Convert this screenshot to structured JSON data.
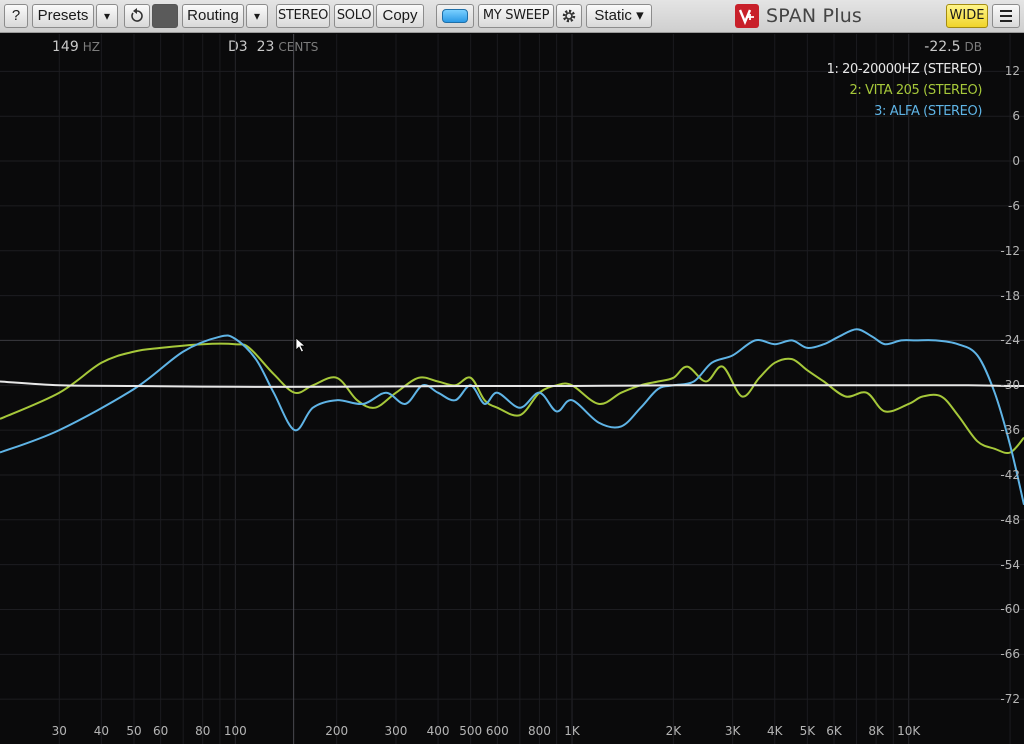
{
  "toolbar": {
    "help_label": "?",
    "presets_label": "Presets",
    "routing_label": "Routing",
    "stereo_label": "STEREO",
    "solo_label": "SOLO",
    "copy_label": "Copy",
    "sweep_label": "MY SWEEP",
    "mode_label": "Static ▾",
    "brand_label": "SPAN Plus",
    "wide_label": "WIDE",
    "arrow_glyph": "▾"
  },
  "readout": {
    "freq_value": "149",
    "freq_unit": "HZ",
    "note_value": "D3",
    "cents_value": "23",
    "cents_unit": "CENTS",
    "db_value": "-22.5",
    "db_unit": "DB"
  },
  "colors": {
    "series1": "#e8e8e8",
    "series2": "#a6c83a",
    "series3": "#5fb4e6",
    "toolbar_bg": "#d9d9d9",
    "wide_yellow": "#f5e04a"
  },
  "chart_data": {
    "type": "line",
    "x_scale": "log",
    "x_unit": "Hz",
    "xlim": [
      20,
      22000
    ],
    "ylim": [
      -78,
      17
    ],
    "y_unit": "dB",
    "grid": true,
    "legend_position": "top-right",
    "y_ticks": [
      "12",
      "6",
      "0",
      "-6",
      "-12",
      "-18",
      "-24",
      "-30",
      "-36",
      "-42",
      "-48",
      "-54",
      "-60",
      "-66",
      "-72"
    ],
    "x_ticks": [
      "30",
      "40",
      "50",
      "60",
      "80",
      "100",
      "200",
      "300",
      "400",
      "500",
      "600",
      "800",
      "1K",
      "2K",
      "3K",
      "4K",
      "5K",
      "6K",
      "8K",
      "10K"
    ],
    "series": [
      {
        "name": "1: 20-20000HZ (STEREO)",
        "color": "#e8e8e8",
        "x": [
          20,
          30,
          50,
          100,
          200,
          500,
          1000,
          2000,
          5000,
          10000,
          15000,
          20000,
          22000
        ],
        "y": [
          -29.5,
          -30,
          -30.1,
          -30.2,
          -30.2,
          -30.1,
          -30.1,
          -30,
          -30,
          -30,
          -30,
          -30.1,
          -30.1
        ]
      },
      {
        "name": "2: VITA 205 (STEREO)",
        "color": "#a6c83a",
        "x": [
          20,
          30,
          40,
          50,
          60,
          80,
          100,
          110,
          130,
          150,
          170,
          200,
          230,
          260,
          300,
          350,
          400,
          450,
          500,
          550,
          600,
          700,
          800,
          900,
          1000,
          1200,
          1400,
          1600,
          1800,
          2000,
          2200,
          2500,
          2800,
          3200,
          3600,
          4000,
          4500,
          5000,
          5600,
          6500,
          7500,
          8500,
          10000,
          11000,
          12500,
          14000,
          16000,
          18000,
          20000,
          22000
        ],
        "y": [
          -34.5,
          -31,
          -27,
          -25.5,
          -25,
          -24.5,
          -24.5,
          -25,
          -28.5,
          -31,
          -30,
          -29,
          -32,
          -33,
          -31,
          -29,
          -29.5,
          -30,
          -29,
          -32,
          -33,
          -34,
          -31,
          -30,
          -30,
          -32.5,
          -31,
          -30,
          -29.5,
          -29,
          -27.5,
          -29.5,
          -27.5,
          -31.5,
          -29,
          -27,
          -26.5,
          -28,
          -29.5,
          -31.5,
          -31,
          -33.5,
          -32.5,
          -31.5,
          -31.5,
          -34,
          -37.5,
          -38.5,
          -39,
          -37
        ]
      },
      {
        "name": "3: ALFA (STEREO)",
        "color": "#5fb4e6",
        "x": [
          20,
          30,
          50,
          70,
          90,
          100,
          115,
          130,
          150,
          170,
          200,
          240,
          280,
          320,
          360,
          400,
          450,
          500,
          550,
          600,
          700,
          800,
          900,
          1000,
          1200,
          1400,
          1600,
          1800,
          2000,
          2300,
          2600,
          3000,
          3500,
          4000,
          4500,
          5000,
          5600,
          6200,
          7000,
          7800,
          8500,
          9500,
          10500,
          12000,
          14000,
          16000,
          18000,
          20000,
          22000
        ],
        "y": [
          -39,
          -36,
          -30.5,
          -25.5,
          -23.5,
          -23.8,
          -26.5,
          -31,
          -36,
          -33,
          -32,
          -32.5,
          -31,
          -32.5,
          -30,
          -31,
          -32,
          -30,
          -32.5,
          -31,
          -33,
          -31,
          -33.5,
          -32,
          -35,
          -35.5,
          -33,
          -30.5,
          -30,
          -29.5,
          -27,
          -26,
          -24,
          -24.5,
          -24,
          -25,
          -24.5,
          -23.5,
          -22.5,
          -23.5,
          -24.5,
          -24,
          -24,
          -24,
          -24.5,
          -26,
          -31,
          -38,
          -46
        ]
      }
    ]
  }
}
